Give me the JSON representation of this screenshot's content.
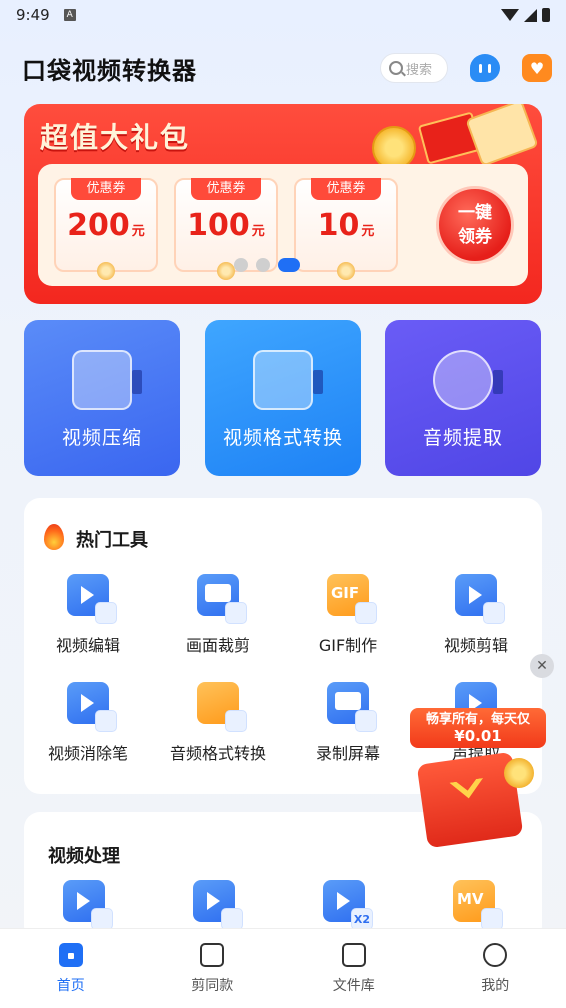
{
  "status_bar": {
    "time": "9:49",
    "a_badge": "A"
  },
  "header": {
    "title": "口袋视频转换器",
    "search_placeholder": "搜索"
  },
  "banner": {
    "title": "超值大礼包",
    "coupons": [
      {
        "tag": "优惠券",
        "value": "200",
        "unit": "元"
      },
      {
        "tag": "优惠券",
        "value": "100",
        "unit": "元"
      },
      {
        "tag": "优惠券",
        "value": "10",
        "unit": "元"
      }
    ],
    "claim_line1": "一键",
    "claim_line2": "领券"
  },
  "features": [
    {
      "label": "视频压缩"
    },
    {
      "label": "视频格式转换"
    },
    {
      "label": "音频提取"
    }
  ],
  "hot_tools": {
    "title": "热门工具",
    "items": [
      {
        "label": "视频编辑",
        "icon": "video-edit-icon"
      },
      {
        "label": "画面裁剪",
        "icon": "crop-icon"
      },
      {
        "label": "GIF制作",
        "icon": "gif-icon"
      },
      {
        "label": "视频剪辑",
        "icon": "video-cut-icon"
      },
      {
        "label": "视频消除笔",
        "icon": "eraser-icon"
      },
      {
        "label": "音频格式转换",
        "icon": "audio-convert-icon"
      },
      {
        "label": "录制屏幕",
        "icon": "screen-record-icon"
      },
      {
        "label": "声提取",
        "icon": "voice-extract-icon"
      }
    ],
    "gif_text": "GIF"
  },
  "video_processing": {
    "title": "视频处理",
    "x2_text": "X2",
    "mv_text": "MV"
  },
  "promo": {
    "line1": "畅享所有，每天仅",
    "line2": "¥0.01",
    "close": "✕"
  },
  "bottom_nav": [
    {
      "label": "首页",
      "active": true
    },
    {
      "label": "剪同款",
      "active": false
    },
    {
      "label": "文件库",
      "active": false
    },
    {
      "label": "我的",
      "active": false
    }
  ]
}
